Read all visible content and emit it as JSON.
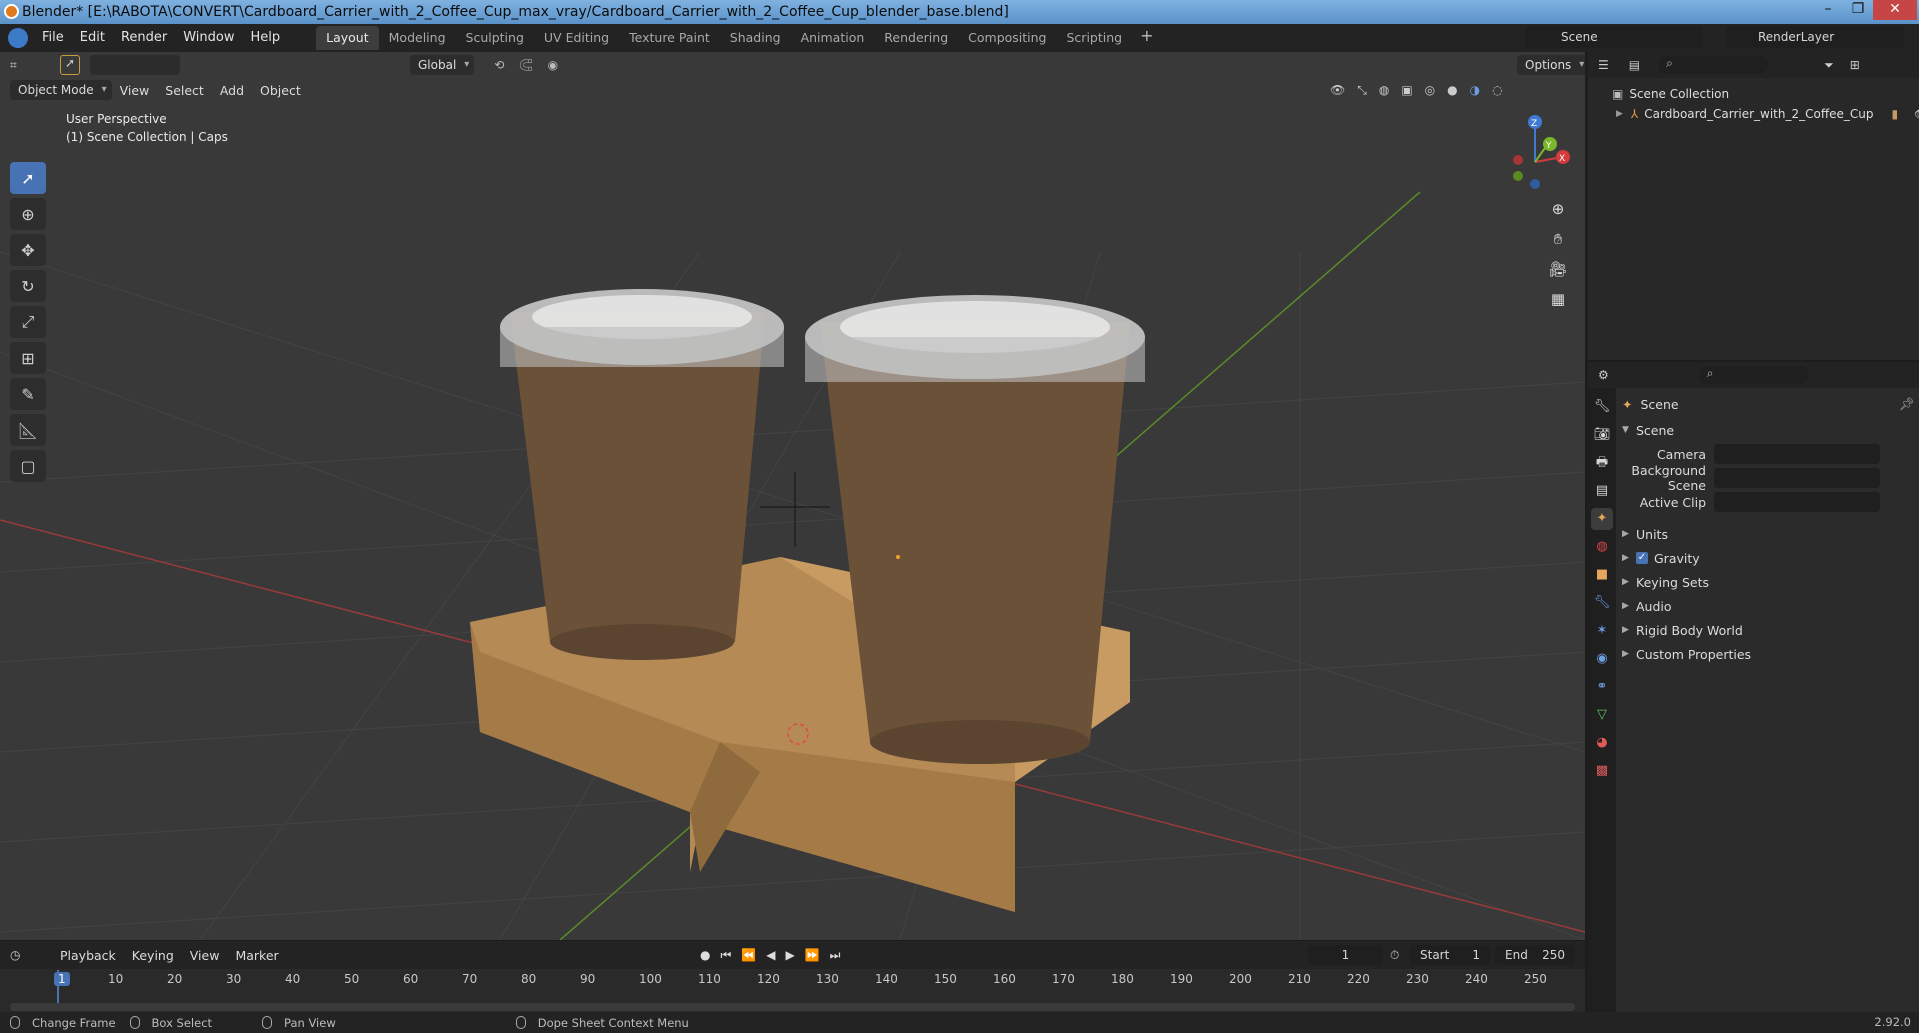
{
  "window": {
    "title": "Blender* [E:\\RABOTA\\CONVERT\\Cardboard_Carrier_with_2_Coffee_Cup_max_vray/Cardboard_Carrier_with_2_Coffee_Cup_blender_base.blend]"
  },
  "menu": [
    "File",
    "Edit",
    "Render",
    "Window",
    "Help"
  ],
  "workspaces": [
    "Layout",
    "Modeling",
    "Sculpting",
    "UV Editing",
    "Texture Paint",
    "Shading",
    "Animation",
    "Rendering",
    "Compositing",
    "Scripting"
  ],
  "active_workspace": "Layout",
  "scene_name": "Scene",
  "render_layer": "RenderLayer",
  "viewport": {
    "mode": "Object Mode",
    "menus": [
      "View",
      "Select",
      "Add",
      "Object"
    ],
    "transform_orientation": "Global",
    "options_label": "Options",
    "overlay_line1": "User Perspective",
    "overlay_line2": "(1) Scene Collection | Caps"
  },
  "gizmo": {
    "x": "X",
    "y": "Y",
    "z": "Z"
  },
  "outliner": {
    "root": "Scene Collection",
    "object": "Cardboard_Carrier_with_2_Coffee_Cup"
  },
  "properties": {
    "header": "Scene",
    "section": "Scene",
    "fields": [
      {
        "label": "Camera"
      },
      {
        "label": "Background Scene"
      },
      {
        "label": "Active Clip"
      }
    ],
    "panels": [
      "Units",
      "Gravity",
      "Keying Sets",
      "Audio",
      "Rigid Body World",
      "Custom Properties"
    ]
  },
  "timeline": {
    "menus": [
      "Playback",
      "Keying",
      "View",
      "Marker"
    ],
    "current_frame": "1",
    "start_label": "Start",
    "start": "1",
    "end_label": "End",
    "end": "250",
    "ticks": [
      "1",
      "10",
      "20",
      "30",
      "40",
      "50",
      "60",
      "70",
      "80",
      "90",
      "100",
      "110",
      "120",
      "130",
      "140",
      "150",
      "160",
      "170",
      "180",
      "190",
      "200",
      "210",
      "220",
      "230",
      "240",
      "250"
    ]
  },
  "status": {
    "items": [
      "Change Frame",
      "Box Select",
      "Pan View",
      "Dope Sheet Context Menu"
    ],
    "version": "2.92.0"
  },
  "colors": {
    "accent": "#4772b3",
    "viewport_bg": "#393939",
    "cardboard": "#b58a54",
    "coffee": "#6b5137"
  }
}
